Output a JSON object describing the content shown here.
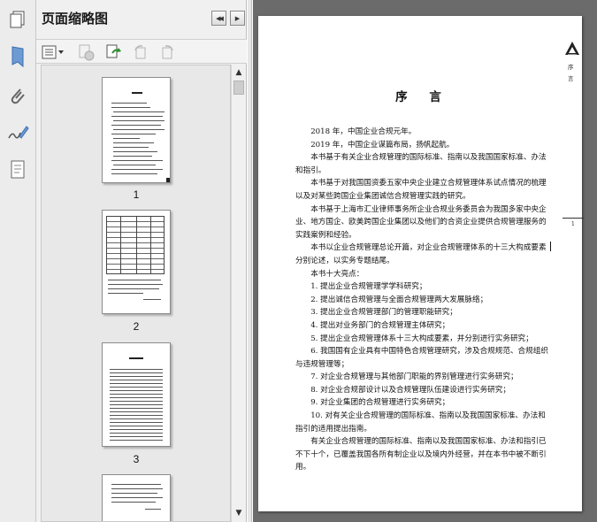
{
  "sidebar": {
    "tools": [
      {
        "icon": "pages-icon"
      },
      {
        "icon": "bookmark-icon"
      },
      {
        "icon": "attachment-icon"
      },
      {
        "icon": "signature-icon"
      },
      {
        "icon": "layers-icon"
      }
    ]
  },
  "panel": {
    "title": "页面缩略图",
    "prev_symbol": "◀◀",
    "next_symbol": "▶",
    "thumbnails": [
      {
        "label": "1"
      },
      {
        "label": "2"
      },
      {
        "label": "3"
      }
    ],
    "scroll_up": "▲",
    "scroll_down": "▼"
  },
  "document": {
    "title": "序 言",
    "header_label": "序言",
    "page_number": "1",
    "paragraphs": [
      "2018 年，中国企业合规元年。",
      "2019 年，中国企业谋篇布局，扬帆起航。",
      "本书基于有关企业合规管理的国际标准、指南以及我国国家标准、办法和指引。",
      "本书基于对我国国资委五家中央企业建立合规管理体系试点情况的梳理以及对某些跨国企业集团诚信合规管理实践的研究。",
      "本书基于上海市汇业律师事务所企业合规业务委员会为我国多家中央企业、地方国企、欧美跨国企业集团以及他们的合资企业提供合规管理服务的实践案例和经验。",
      "本书以企业合规管理总论开篇，对企业合规管理体系的十三大构成要素分别论述，以实务专题结尾。",
      "本书十大亮点：",
      "1. 提出企业合规管理学学科研究；",
      "2. 提出诚信合规管理与全面合规管理两大发展脉络；",
      "3. 提出企业合规管理部门的管理职能研究；",
      "4. 提出对业务部门的合规管理主体研究；",
      "5. 提出企业合规管理体系十三大构成要素，并分别进行实务研究；",
      "6. 我国国有企业具有中国特色合规管理研究，涉及合规规范、合规组织与违规管理等；",
      "7. 对企业合规管理与其他部门职能的界别管理进行实务研究；",
      "8. 对企业合规部设计以及合规管理队伍建设进行实务研究；",
      "9. 对企业集团的合规管理进行实务研究；",
      "10. 对有关企业合规管理的国际标准、指南以及我国国家标准、办法和指引的适用提出指南。",
      "有关企业合规管理的国际标准、指南以及我国国家标准、办法和指引已不下十个，已覆盖我国各所有制企业以及境内外经营，并在本书中被不断引用。"
    ]
  },
  "colors": {
    "panel_bg": "#f0f0f0",
    "doc_bg": "#6b6b6b",
    "icon_blue": "#3a6fb0"
  }
}
